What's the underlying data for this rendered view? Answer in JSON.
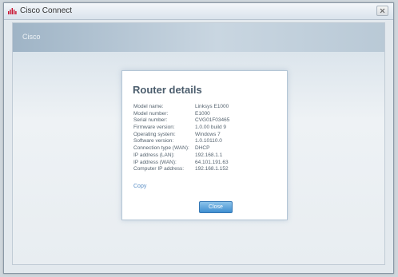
{
  "window": {
    "title": "Cisco Connect"
  },
  "client": {
    "brand_label": "Cisco"
  },
  "dialog": {
    "title": "Router details",
    "details": [
      {
        "label": "Model name:",
        "value": "Linksys E1000"
      },
      {
        "label": "Model number:",
        "value": "E1000"
      },
      {
        "label": "Serial number:",
        "value": "CVG01F03465"
      },
      {
        "label": "Firmware version:",
        "value": "1.0.00 build 9"
      },
      {
        "label": "Operating system:",
        "value": "Windows 7"
      },
      {
        "label": "Software version:",
        "value": "1.0.10110.0"
      },
      {
        "label": "Connection type (WAN):",
        "value": "DHCP"
      },
      {
        "label": "IP address (LAN):",
        "value": "192.168.1.1"
      },
      {
        "label": "IP address (WAN):",
        "value": "64.101.191.63"
      },
      {
        "label": "Computer IP address:",
        "value": "192.168.1.152"
      }
    ],
    "copy_label": "Copy",
    "close_label": "Close"
  },
  "colors": {
    "accent": "#3f8fd0",
    "title": "#4b5d6d",
    "link": "#5a8fc6"
  },
  "icons": {
    "app": "cisco-logo-icon",
    "close": "close-icon"
  }
}
